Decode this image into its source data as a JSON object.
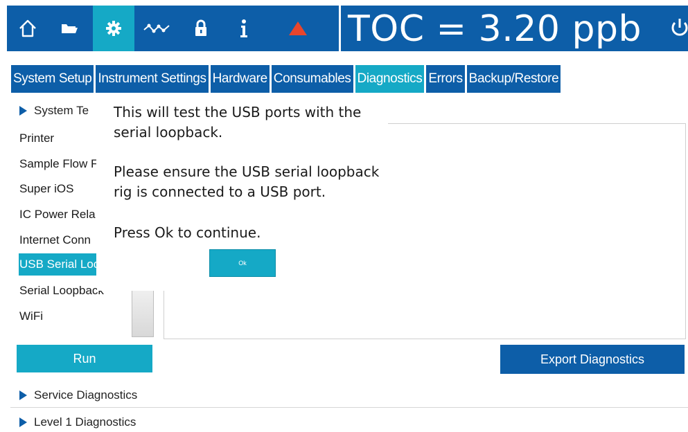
{
  "header": {
    "toc_reading": "TOC = 3.20 ppb",
    "toolbar": [
      {
        "icon": "home-icon"
      },
      {
        "icon": "folder-icon"
      },
      {
        "icon": "gear-icon",
        "active": true
      },
      {
        "icon": "trend-icon"
      },
      {
        "icon": "lock-icon"
      },
      {
        "icon": "info-icon"
      },
      {
        "icon": "alarm-icon"
      }
    ],
    "power_icon": "power-icon"
  },
  "tabs": [
    {
      "label": "System Setup"
    },
    {
      "label": "Instrument Settings"
    },
    {
      "label": "Hardware"
    },
    {
      "label": "Consumables"
    },
    {
      "label": "Diagnostics",
      "active": true
    },
    {
      "label": "Errors"
    },
    {
      "label": "Backup/Restore"
    }
  ],
  "sections": {
    "system_tests": "System Te",
    "service": "Service Diagnostics",
    "level1": "Level 1 Diagnostics"
  },
  "test_list": [
    {
      "label": "Printer"
    },
    {
      "label": "Sample Flow F"
    },
    {
      "label": "Super iOS"
    },
    {
      "label": "IC Power Rela"
    },
    {
      "label": "Internet Conn"
    },
    {
      "label": "USB Serial Loo",
      "selected": true
    },
    {
      "label": "Serial Loopback"
    },
    {
      "label": "WiFi"
    }
  ],
  "dialog": {
    "line1": "This will test the USB ports with the",
    "line2": "serial loopback.",
    "line3": "Please ensure the USB serial loopback",
    "line4": "rig is connected to a USB port.",
    "line5": "Press Ok to continue.",
    "ok_label": "Ok"
  },
  "buttons": {
    "run": "Run",
    "export": "Export Diagnostics"
  },
  "colors": {
    "primary": "#0d5ea8",
    "accent": "#15a9c6",
    "alarm": "#e8452c"
  }
}
